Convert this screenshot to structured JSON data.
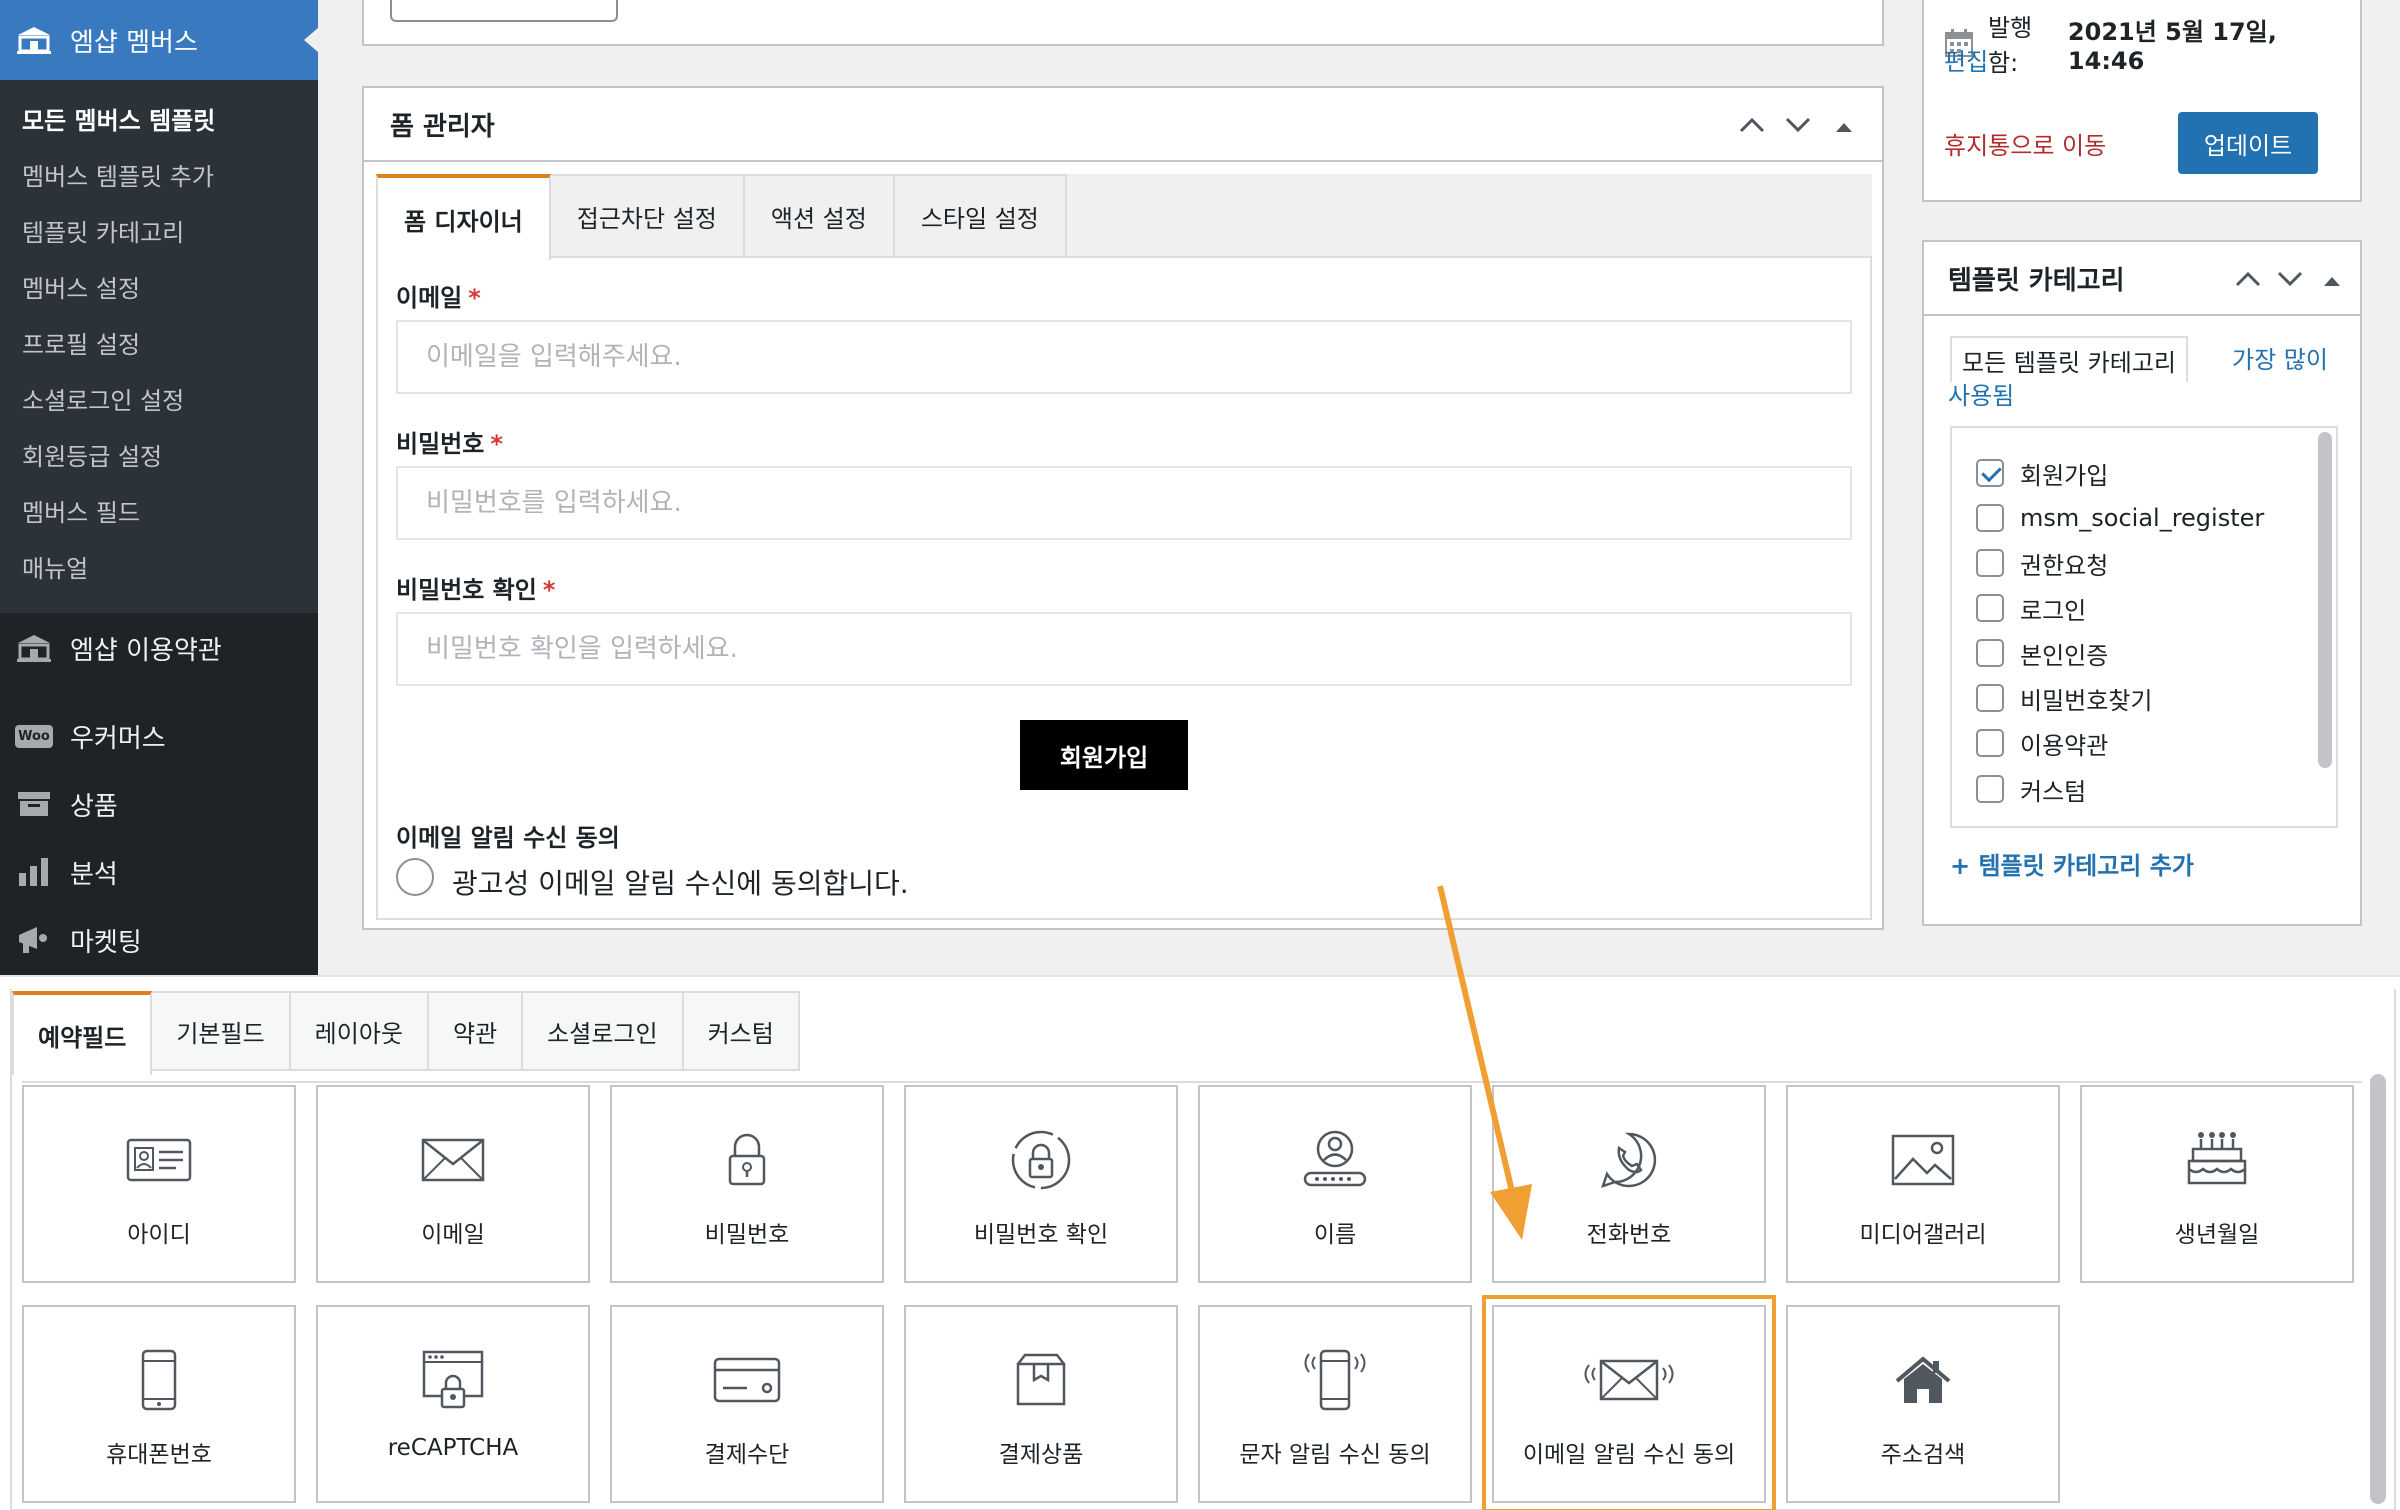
{
  "sidebar": {
    "active_menu": {
      "label": "엠샵 멤버스",
      "icon": "building-icon"
    },
    "submenu": [
      {
        "label": "모든 멤버스 템플릿",
        "current": true
      },
      {
        "label": "멤버스 템플릿 추가"
      },
      {
        "label": "템플릿 카테고리"
      },
      {
        "label": "멤버스 설정"
      },
      {
        "label": "프로필 설정"
      },
      {
        "label": "소셜로그인 설정"
      },
      {
        "label": "회원등급 설정"
      },
      {
        "label": "멤버스 필드"
      },
      {
        "label": "매뉴얼"
      }
    ],
    "menus": [
      {
        "label": "엠샵 이용약관",
        "icon": "building-icon"
      },
      {
        "label": "우커머스",
        "icon": "woo-icon",
        "icon_text": "Woo"
      },
      {
        "label": "상품",
        "icon": "archive-icon"
      },
      {
        "label": "분석",
        "icon": "bar-chart-icon"
      },
      {
        "label": "마켓팅",
        "icon": "megaphone-icon"
      }
    ]
  },
  "form_manager": {
    "title": "폼 관리자",
    "tabs": [
      "폼 디자이너",
      "접근차단 설정",
      "액션 설정",
      "스타일 설정"
    ],
    "fields": [
      {
        "label": "이메일",
        "required": "*",
        "placeholder": "이메일을 입력해주세요."
      },
      {
        "label": "비밀번호",
        "required": "*",
        "placeholder": "비밀번호를 입력하세요."
      },
      {
        "label": "비밀번호 확인",
        "required": "*",
        "placeholder": "비밀번호 확인을 입력하세요."
      }
    ],
    "submit_label": "회원가입",
    "consent": {
      "title": "이메일 알림 수신 동의",
      "option": "광고성 이메일 알림 수신에 동의합니다."
    }
  },
  "publish": {
    "published_prefix": "발행함:",
    "published_date": "2021년 5월 17일, 14:46",
    "edit_label": "편집",
    "trash_label": "휴지통으로 이동",
    "update_label": "업데이트"
  },
  "categories": {
    "title": "템플릿 카테고리",
    "tab_all": "모든 템플릿 카테고리",
    "tab_popular": "가장 많이 사용됨",
    "items": [
      {
        "label": "회원가입",
        "checked": true
      },
      {
        "label": "msm_social_register",
        "checked": false
      },
      {
        "label": "권한요청",
        "checked": false
      },
      {
        "label": "로그인",
        "checked": false
      },
      {
        "label": "본인인증",
        "checked": false
      },
      {
        "label": "비밀번호찾기",
        "checked": false
      },
      {
        "label": "이용약관",
        "checked": false
      },
      {
        "label": "커스텀",
        "checked": false
      }
    ],
    "add_label": "+ 템플릿 카테고리 추가"
  },
  "field_picker": {
    "tabs": [
      "예약필드",
      "기본필드",
      "레이아웃",
      "약관",
      "소셜로그인",
      "커스텀"
    ],
    "tiles": [
      {
        "label": "아이디",
        "icon": "id-card-icon"
      },
      {
        "label": "이메일",
        "icon": "envelope-icon"
      },
      {
        "label": "비밀번호",
        "icon": "lock-icon"
      },
      {
        "label": "비밀번호 확인",
        "icon": "lock-circle-icon"
      },
      {
        "label": "이름",
        "icon": "user-icon"
      },
      {
        "label": "전화번호",
        "icon": "phone-icon"
      },
      {
        "label": "미디어갤러리",
        "icon": "image-icon"
      },
      {
        "label": "생년월일",
        "icon": "cake-icon"
      },
      {
        "label": "휴대폰번호",
        "icon": "mobile-icon"
      },
      {
        "label": "reCAPTCHA",
        "icon": "browser-lock-icon"
      },
      {
        "label": "결제수단",
        "icon": "credit-card-icon"
      },
      {
        "label": "결제상품",
        "icon": "box-icon"
      },
      {
        "label": "문자 알림 수신 동의",
        "icon": "mobile-ring-icon"
      },
      {
        "label": "이메일 알림 수신 동의",
        "icon": "envelope-ring-icon",
        "highlighted": true
      },
      {
        "label": "주소검색",
        "icon": "home-icon"
      }
    ]
  },
  "colors": {
    "sidebar_bg": "#1d2327",
    "sidebar_active": "#3979c0",
    "accent_orange": "#e07f21",
    "link_blue": "#2271b1",
    "trash_red": "#b32d2e",
    "required_red": "#d63638",
    "highlight_orange": "#f0a033"
  }
}
